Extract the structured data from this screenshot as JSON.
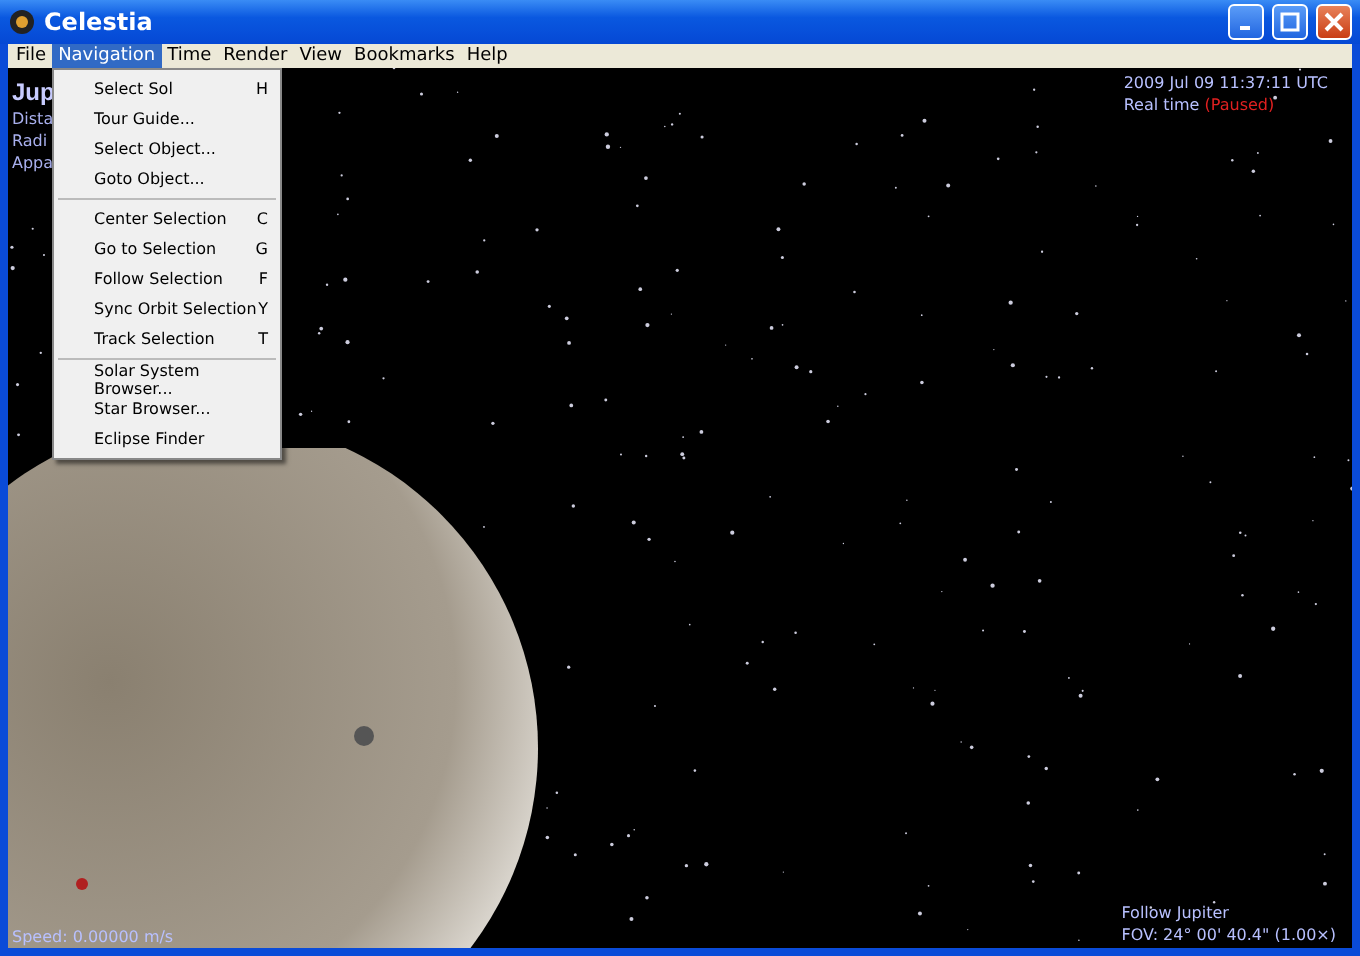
{
  "window": {
    "title": "Celestia"
  },
  "menu_bar": [
    {
      "label": "File",
      "selected": false
    },
    {
      "label": "Navigation",
      "selected": true
    },
    {
      "label": "Time",
      "selected": false
    },
    {
      "label": "Render",
      "selected": false
    },
    {
      "label": "View",
      "selected": false
    },
    {
      "label": "Bookmarks",
      "selected": false
    },
    {
      "label": "Help",
      "selected": false
    }
  ],
  "dropdown": {
    "sections": [
      [
        {
          "label": "Select Sol",
          "shortcut": "H"
        },
        {
          "label": "Tour Guide..."
        },
        {
          "label": "Select Object..."
        },
        {
          "label": "Goto Object..."
        }
      ],
      [
        {
          "label": "Center Selection",
          "shortcut": "C"
        },
        {
          "label": "Go to Selection",
          "shortcut": "G"
        },
        {
          "label": "Follow Selection",
          "shortcut": "F"
        },
        {
          "label": "Sync Orbit Selection",
          "shortcut": "Y"
        },
        {
          "label": "Track Selection",
          "shortcut": "T"
        }
      ],
      [
        {
          "label": "Solar System Browser..."
        },
        {
          "label": "Star Browser..."
        },
        {
          "label": "Eclipse Finder"
        }
      ]
    ]
  },
  "object_info": {
    "name": "Jup",
    "lines": [
      "Dista",
      "Radi",
      "Appa"
    ]
  },
  "time_info": {
    "date": "2009 Jul 09 11:37:11 UTC",
    "rate": "Real time",
    "status": "(Paused)"
  },
  "speed": "Speed: 0.00000 m/s",
  "follow_info": {
    "mode": "Follow Jupiter",
    "fov": "FOV: 24° 00' 40.4\" (1.00×)"
  }
}
